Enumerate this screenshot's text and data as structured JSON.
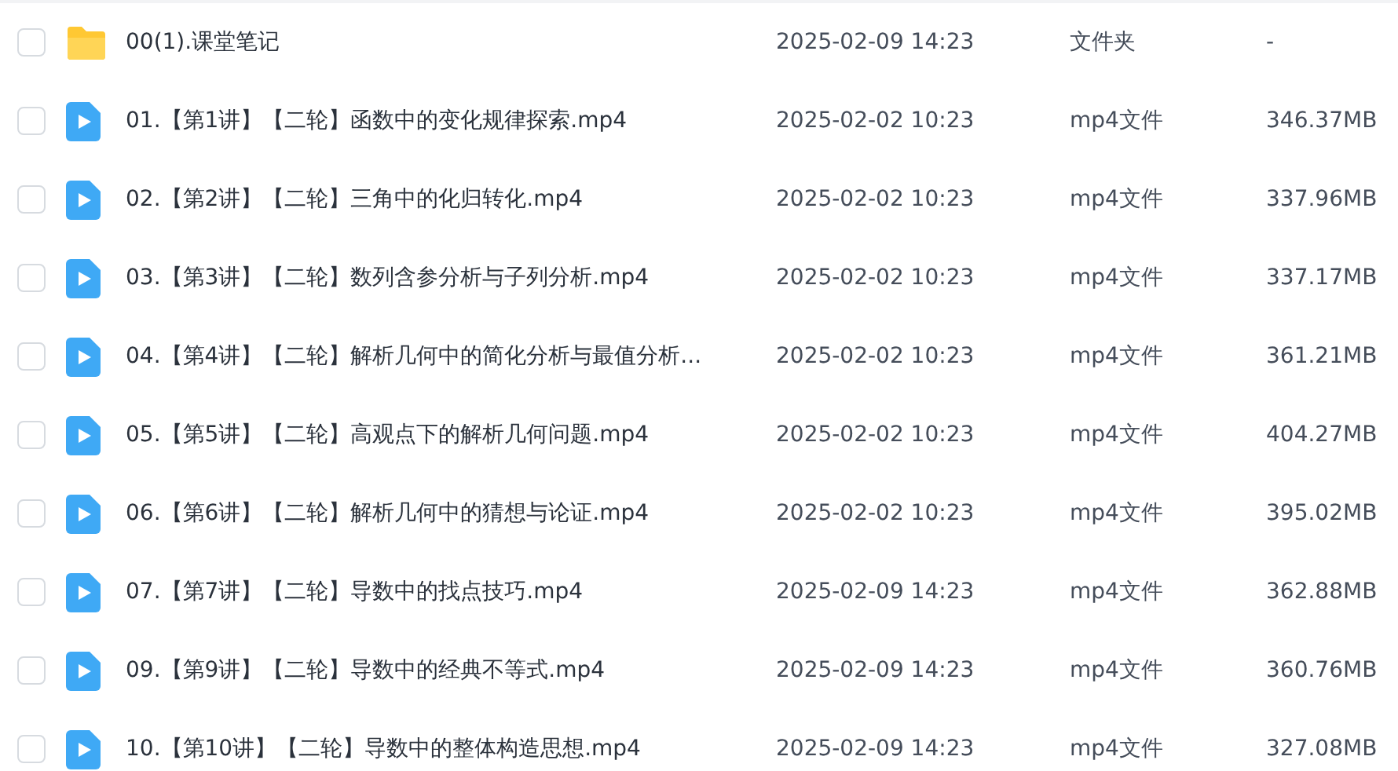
{
  "files": [
    {
      "kind": "folder",
      "checked": false,
      "name": "00(1).课堂笔记",
      "modified": "2025-02-09 14:23",
      "type": "文件夹",
      "size": "-"
    },
    {
      "kind": "video",
      "checked": false,
      "name": "01.【第1讲】【二轮】函数中的变化规律探索.mp4",
      "modified": "2025-02-02 10:23",
      "type": "mp4文件",
      "size": "346.37MB"
    },
    {
      "kind": "video",
      "checked": false,
      "name": "02.【第2讲】【二轮】三角中的化归转化.mp4",
      "modified": "2025-02-02 10:23",
      "type": "mp4文件",
      "size": "337.96MB"
    },
    {
      "kind": "video",
      "checked": false,
      "name": "03.【第3讲】【二轮】数列含参分析与子列分析.mp4",
      "modified": "2025-02-02 10:23",
      "type": "mp4文件",
      "size": "337.17MB"
    },
    {
      "kind": "video",
      "checked": false,
      "name": "04.【第4讲】【二轮】解析几何中的简化分析与最值分析...",
      "modified": "2025-02-02 10:23",
      "type": "mp4文件",
      "size": "361.21MB"
    },
    {
      "kind": "video",
      "checked": false,
      "name": "05.【第5讲】【二轮】高观点下的解析几何问题.mp4",
      "modified": "2025-02-02 10:23",
      "type": "mp4文件",
      "size": "404.27MB"
    },
    {
      "kind": "video",
      "checked": false,
      "name": "06.【第6讲】【二轮】解析几何中的猜想与论证.mp4",
      "modified": "2025-02-02 10:23",
      "type": "mp4文件",
      "size": "395.02MB"
    },
    {
      "kind": "video",
      "checked": false,
      "name": "07.【第7讲】【二轮】导数中的找点技巧.mp4",
      "modified": "2025-02-09 14:23",
      "type": "mp4文件",
      "size": "362.88MB"
    },
    {
      "kind": "video",
      "checked": false,
      "name": "09.【第9讲】【二轮】导数中的经典不等式.mp4",
      "modified": "2025-02-09 14:23",
      "type": "mp4文件",
      "size": "360.76MB"
    },
    {
      "kind": "video",
      "checked": false,
      "name": "10.【第10讲】【二轮】导数中的整体构造思想.mp4",
      "modified": "2025-02-09 14:23",
      "type": "mp4文件",
      "size": "327.08MB"
    }
  ]
}
